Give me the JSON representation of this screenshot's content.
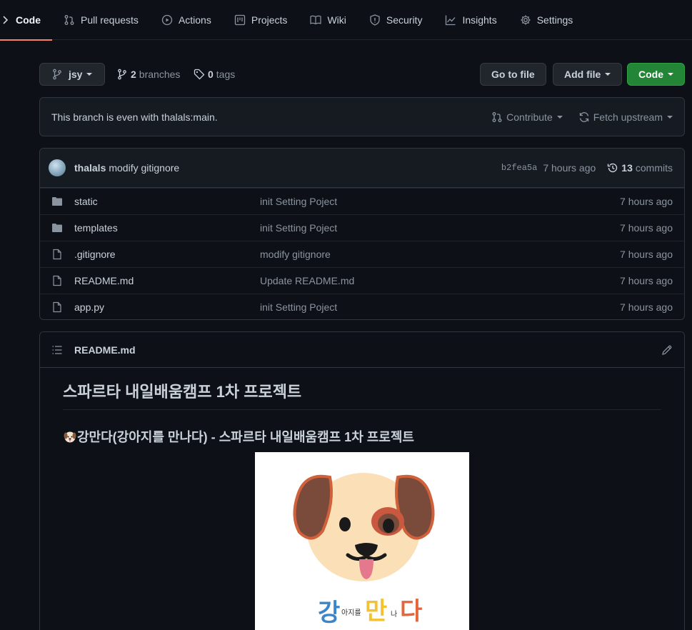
{
  "tabs": [
    {
      "label": "Code"
    },
    {
      "label": "Pull requests"
    },
    {
      "label": "Actions"
    },
    {
      "label": "Projects"
    },
    {
      "label": "Wiki"
    },
    {
      "label": "Security"
    },
    {
      "label": "Insights"
    },
    {
      "label": "Settings"
    }
  ],
  "branch": {
    "name": "jsy",
    "branches_count": "2",
    "branches_label": "branches",
    "tags_count": "0",
    "tags_label": "tags"
  },
  "toolbar": {
    "go_to_file": "Go to file",
    "add_file": "Add file",
    "code": "Code"
  },
  "status": {
    "text": "This branch is even with thalals:main.",
    "contribute": "Contribute",
    "fetch_upstream": "Fetch upstream"
  },
  "commit": {
    "author": "thalals",
    "message": "modify gitignore",
    "sha": "b2fea5a",
    "time": "7 hours ago",
    "commits_count": "13",
    "commits_label": "commits"
  },
  "files": [
    {
      "type": "folder",
      "name": "static",
      "message": "init Setting Poject",
      "time": "7 hours ago"
    },
    {
      "type": "folder",
      "name": "templates",
      "message": "init Setting Poject",
      "time": "7 hours ago"
    },
    {
      "type": "file",
      "name": ".gitignore",
      "message": "modify gitignore",
      "time": "7 hours ago"
    },
    {
      "type": "file",
      "name": "README.md",
      "message": "Update README.md",
      "time": "7 hours ago"
    },
    {
      "type": "file",
      "name": "app.py",
      "message": "init Setting Poject",
      "time": "7 hours ago"
    }
  ],
  "readme": {
    "filename": "README.md",
    "h1": "스파르타 내일배움캠프 1차 프로젝트",
    "h3": "강만다(강아지를 만나다) - 스파르타 내일배움캠프 1차 프로젝트",
    "logo_text": {
      "gang": "강",
      "ajireul": "아지를",
      "man": "만",
      "na": "나",
      "da": "다"
    }
  },
  "colors": {
    "accent_tab": "#f78166",
    "green_button": "#238636",
    "background": "#0d1117"
  },
  "icons": [
    "code-icon",
    "pull-request-icon",
    "actions-icon",
    "projects-icon",
    "wiki-icon",
    "security-icon",
    "insights-icon",
    "settings-icon",
    "branch-icon",
    "tag-icon",
    "history-icon",
    "folder-icon",
    "file-icon",
    "list-icon",
    "pencil-icon",
    "sync-icon",
    "dog-emoji-icon"
  ]
}
